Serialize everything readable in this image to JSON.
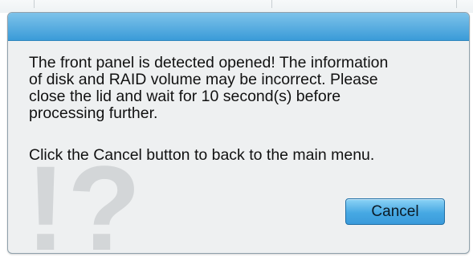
{
  "dialog": {
    "message_lines": [
      "The front panel is detected opened! The information",
      "of disk and RAID volume may be incorrect. Please",
      "close the lid and wait for 10 second(s) before",
      "processing further."
    ],
    "instruction": "Click the Cancel button to back to the main menu.",
    "cancel_label": "Cancel",
    "watermark": "!?"
  },
  "colors": {
    "titlebar": "#3a9bd8",
    "button": "#46a8e3",
    "dialog_background": "#eef0f1",
    "watermark": "#d3d6d8"
  }
}
